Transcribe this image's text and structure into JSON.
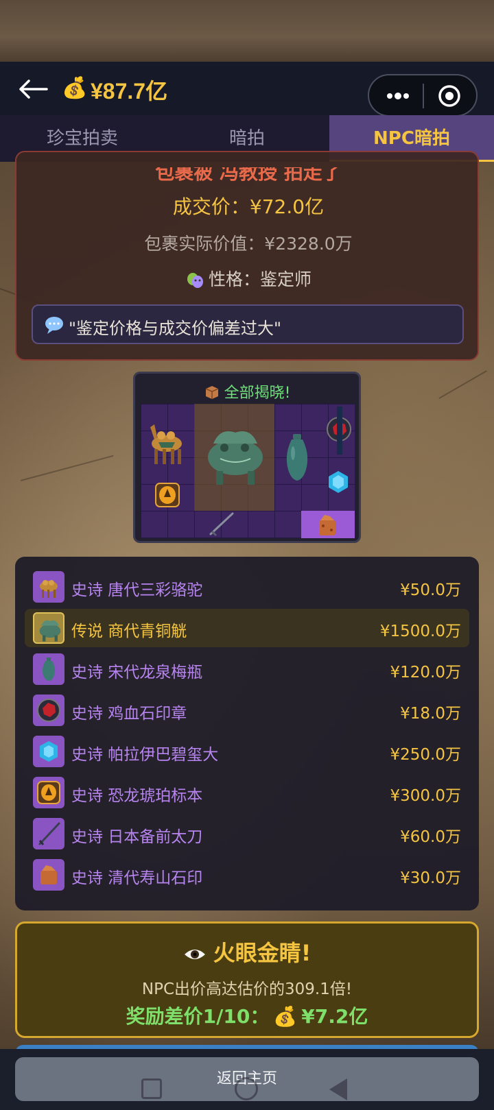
{
  "header": {
    "balance": "¥87.7亿",
    "money_icon": "💰"
  },
  "tabs": [
    {
      "label": "珍宝拍卖",
      "active": false
    },
    {
      "label": "暗拍",
      "active": false
    },
    {
      "label": "NPC暗拍",
      "active": true
    }
  ],
  "result": {
    "winner_line": "包裹被 冯教授 拍走了",
    "deal_price": "成交价：¥72.0亿",
    "actual_value": "包裹实际价值：¥2328.0万",
    "personality": "性格：鉴定师",
    "comment": "\"鉴定价格与成交价偏差过大\""
  },
  "reveal": {
    "title": "全部揭晓!"
  },
  "items": [
    {
      "name": "史诗 唐代三彩骆驼",
      "price": "¥50.0万",
      "rarity": "epic",
      "icon": "camel-icon"
    },
    {
      "name": "传说 商代青铜觥",
      "price": "¥1500.0万",
      "rarity": "legend",
      "icon": "bronze-vessel-icon"
    },
    {
      "name": "史诗 宋代龙泉梅瓶",
      "price": "¥120.0万",
      "rarity": "epic",
      "icon": "vase-icon"
    },
    {
      "name": "史诗 鸡血石印章",
      "price": "¥18.0万",
      "rarity": "epic",
      "icon": "seal-stone-icon"
    },
    {
      "name": "史诗 帕拉伊巴碧玺大",
      "price": "¥250.0万",
      "rarity": "epic",
      "icon": "gem-icon"
    },
    {
      "name": "史诗 恐龙琥珀标本",
      "price": "¥300.0万",
      "rarity": "epic",
      "icon": "amber-icon"
    },
    {
      "name": "史诗 日本备前太刀",
      "price": "¥60.0万",
      "rarity": "epic",
      "icon": "sword-icon"
    },
    {
      "name": "史诗 清代寿山石印",
      "price": "¥30.0万",
      "rarity": "epic",
      "icon": "stone-seal-icon"
    }
  ],
  "bonus": {
    "title": "火眼金睛!",
    "desc": "NPC出价高达估价的309.1倍!",
    "reward_label": "奖励差价1/10：",
    "reward_value": "¥7.2亿",
    "money_icon": "💰"
  },
  "footer": {
    "home_label": "返回主页"
  },
  "colors": {
    "gold": "#f5c542",
    "epic": "#b784f0",
    "green": "#7ee06a",
    "tab_active": "#56447f"
  }
}
